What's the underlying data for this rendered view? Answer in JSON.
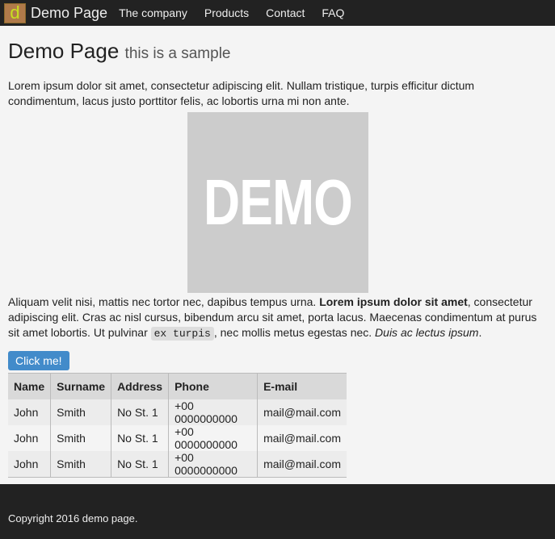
{
  "nav": {
    "logo": "d",
    "brand": "Demo Page",
    "links": [
      "The company",
      "Products",
      "Contact",
      "FAQ"
    ]
  },
  "header": {
    "title": "Demo Page",
    "subtitle": "this is a sample"
  },
  "intro": "Lorem ipsum dolor sit amet, consectetur adipiscing elit. Nullam tristique, turpis efficitur dictum condimentum, lacus justo porttitor felis, ac lobortis urna mi non ante.",
  "image_text": "DEMO",
  "para2": {
    "a": "Aliquam velit nisi, mattis nec tortor nec, dapibus tempus urna. ",
    "bold": "Lorem ipsum dolor sit amet",
    "b": ", consectetur adipiscing elit. Cras ac nisl cursus, bibendum arcu sit amet, porta lacus. Maecenas condimentum at purus sit amet lobortis. Ut pulvinar ",
    "code": "ex turpis",
    "c": ", nec mollis metus egestas nec. ",
    "italic": "Duis ac lectus ipsum",
    "d": "."
  },
  "button": "Click me!",
  "table": {
    "headers": [
      "Name",
      "Surname",
      "Address",
      "Phone",
      "E-mail"
    ],
    "rows": [
      [
        "John",
        "Smith",
        "No St. 1",
        "+00 0000000000",
        "mail@mail.com"
      ],
      [
        "John",
        "Smith",
        "No St. 1",
        "+00 0000000000",
        "mail@mail.com"
      ],
      [
        "John",
        "Smith",
        "No St. 1",
        "+00 0000000000",
        "mail@mail.com"
      ]
    ]
  },
  "footer": "Copyright 2016 demo page."
}
